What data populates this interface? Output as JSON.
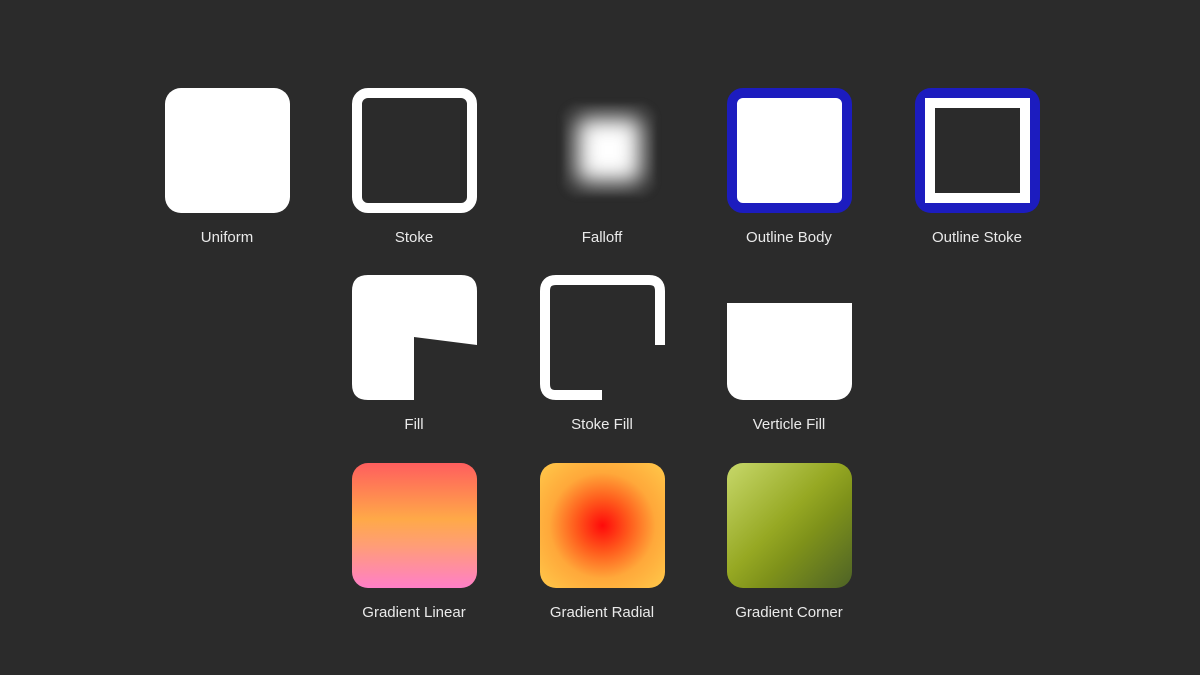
{
  "styles": [
    {
      "id": "uniform",
      "label": "Uniform"
    },
    {
      "id": "stoke",
      "label": "Stoke"
    },
    {
      "id": "falloff",
      "label": "Falloff"
    },
    {
      "id": "outline-body",
      "label": "Outline Body"
    },
    {
      "id": "outline-stoke",
      "label": "Outline Stoke"
    },
    {
      "id": "fill",
      "label": "Fill"
    },
    {
      "id": "stoke-fill",
      "label": "Stoke Fill"
    },
    {
      "id": "verticle-fill",
      "label": "Verticle Fill"
    },
    {
      "id": "gradient-linear",
      "label": "Gradient Linear"
    },
    {
      "id": "gradient-radial",
      "label": "Gradient Radial"
    },
    {
      "id": "gradient-corner",
      "label": "Gradient Corner"
    }
  ],
  "colors": {
    "background": "#2b2b2b",
    "white": "#ffffff",
    "outline_blue": "#1c1cbf",
    "caption": "#eaeaea"
  }
}
